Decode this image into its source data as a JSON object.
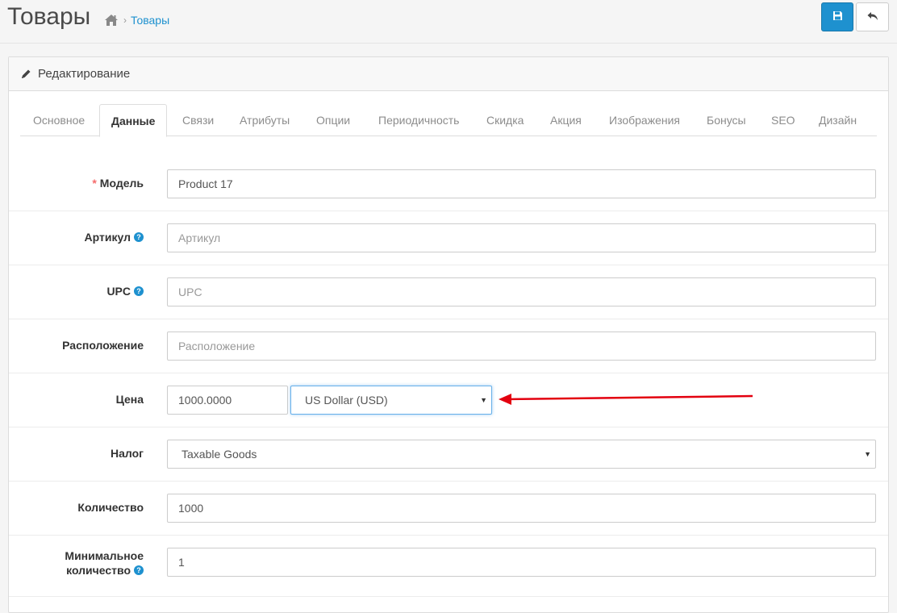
{
  "header": {
    "title": "Товары",
    "breadcrumb_sep": "›",
    "breadcrumb_link": "Товары"
  },
  "panel": {
    "title": "Редактирование"
  },
  "tabs": [
    {
      "label": "Основное",
      "active": false
    },
    {
      "label": "Данные",
      "active": true
    },
    {
      "label": "Связи",
      "active": false
    },
    {
      "label": "Атрибуты",
      "active": false
    },
    {
      "label": "Опции",
      "active": false
    },
    {
      "label": "Периодичность",
      "active": false
    },
    {
      "label": "Скидка",
      "active": false
    },
    {
      "label": "Акция",
      "active": false
    },
    {
      "label": "Изображения",
      "active": false
    },
    {
      "label": "Бонусы",
      "active": false
    },
    {
      "label": "SEO",
      "active": false
    },
    {
      "label": "Дизайн",
      "active": false
    }
  ],
  "form": {
    "model": {
      "label": "Модель",
      "required_mark": "*",
      "value": "Product 17"
    },
    "sku": {
      "label": "Артикул",
      "help": "?",
      "placeholder": "Артикул"
    },
    "upc": {
      "label": "UPC",
      "help": "?",
      "placeholder": "UPC"
    },
    "location": {
      "label": "Расположение",
      "placeholder": "Расположение"
    },
    "price": {
      "label": "Цена",
      "value": "1000.0000",
      "currency": "US Dollar (USD)"
    },
    "tax": {
      "label": "Налог",
      "value": "Taxable Goods"
    },
    "quantity": {
      "label": "Количество",
      "value": "1000"
    },
    "min_quantity": {
      "label_line1": "Минимальное",
      "label_line2": "количество",
      "help": "?",
      "value": "1"
    }
  },
  "colors": {
    "primary": "#1e91cf",
    "annotation_arrow": "#e3000f"
  }
}
